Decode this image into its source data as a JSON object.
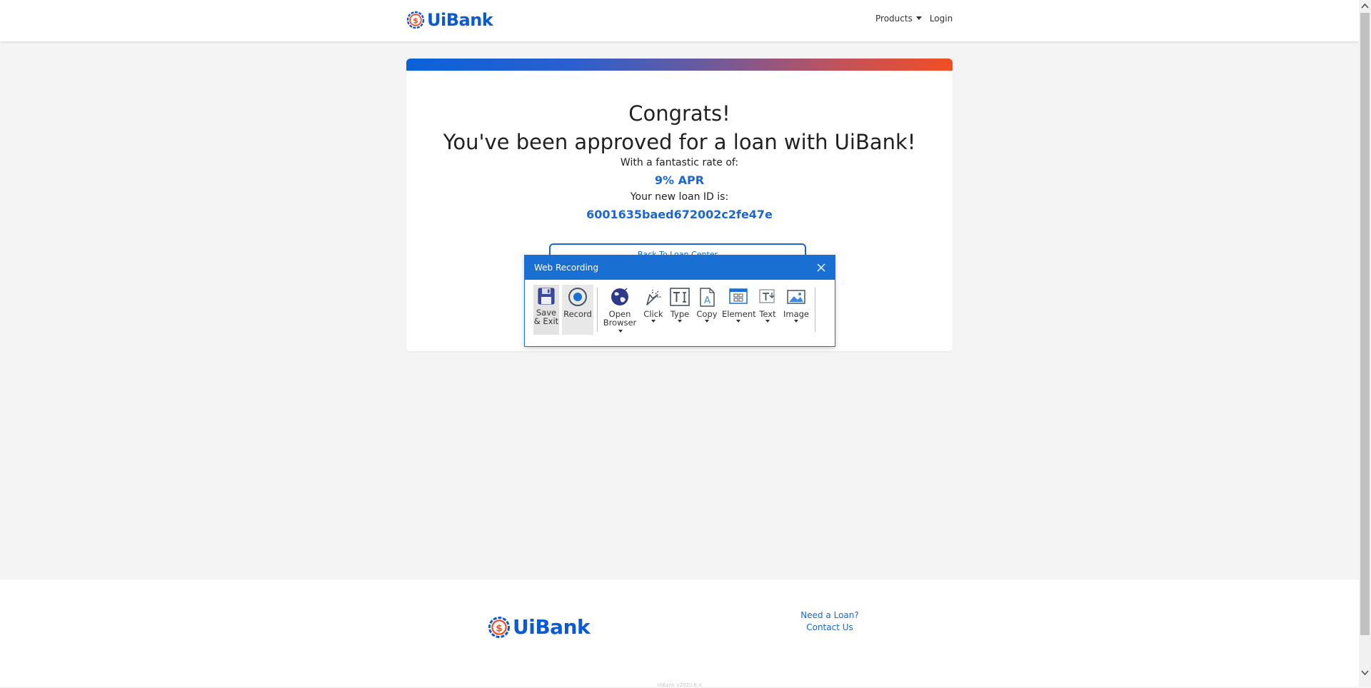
{
  "header": {
    "brand": "UiBank",
    "nav": {
      "products": "Products",
      "login": "Login"
    }
  },
  "card": {
    "congrats": "Congrats!",
    "approved": "You've been approved for a loan with UiBank!",
    "rate_label": "With a fantastic rate of:",
    "rate_value": "9% APR",
    "id_label": "Your new loan ID is:",
    "id_value": "6001635baed672002c2fe47e",
    "back_button": "Back To Loan Center"
  },
  "recording_dialog": {
    "title": "Web Recording",
    "tools": {
      "save_line1": "Save",
      "save_line2": "& Exit",
      "record": "Record",
      "open_line1": "Open",
      "open_line2": "Browser",
      "click": "Click",
      "type": "Type",
      "copy": "Copy",
      "element": "Element",
      "text": "Text",
      "image": "Image"
    }
  },
  "footer": {
    "brand": "UiBank",
    "need_loan": "Need a Loan?",
    "contact": "Contact Us",
    "version": "UiBank v2020.8.4"
  },
  "colors": {
    "brand_blue": "#0a5ad6",
    "accent_orange": "#f24e22",
    "link_blue": "#1a66d2",
    "dialog_blue": "#1a70d2"
  }
}
